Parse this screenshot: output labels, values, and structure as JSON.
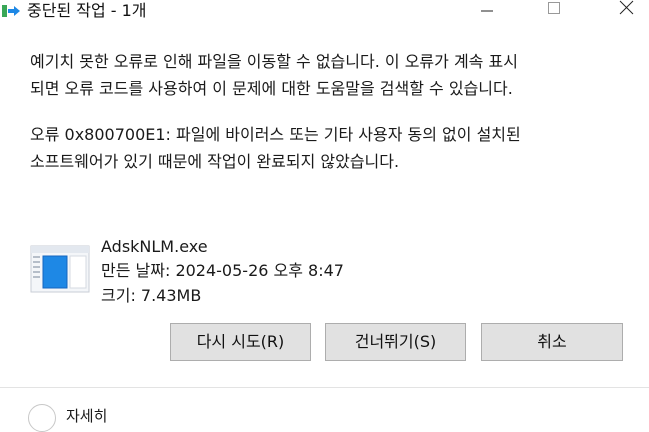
{
  "window": {
    "title": "중단된 작업 - 1개",
    "icons": {
      "app": "move-file-icon",
      "minimize": "minimize-icon",
      "maximize": "maximize-icon",
      "close": "close-icon"
    }
  },
  "message": {
    "main": "예기치 못한 오류로 인해 파일을 이동할 수 없습니다. 이 오류가 계속 표시\n되면 오류 코드를 사용하여 이 문제에 대한 도움말을 검색할 수 있습니다.",
    "detail": "오류 0x800700E1: 파일에 바이러스 또는 기타 사용자 동의 없이 설치된\n소프트웨어가 있기 때문에 작업이 완료되지 않았습니다."
  },
  "file": {
    "icon": "document-icon",
    "name": "AdskNLM.exe",
    "date": "만든 날짜: 2024-05-26 오후 8:47",
    "size": "크기: 7.43MB"
  },
  "buttons": {
    "retry": "다시 시도(R)",
    "skip": "건너뛰기(S)",
    "cancel": "취소"
  },
  "details": {
    "label": "자세히"
  },
  "colors": {
    "button_bg": "#e1e1e1",
    "button_border": "#adadad",
    "icon_blue": "#1e88e5",
    "icon_green": "#3aa757"
  }
}
